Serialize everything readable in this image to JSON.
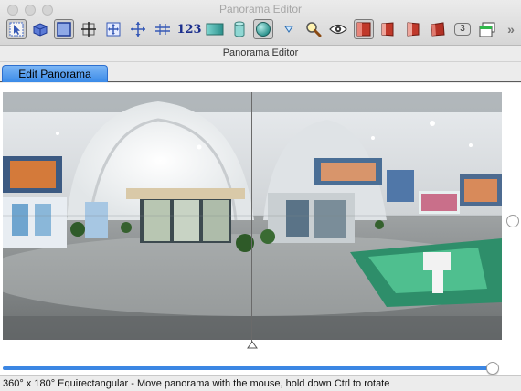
{
  "window": {
    "title": "Panorama Editor"
  },
  "toolbar": {
    "items": [
      {
        "icon": "select-arrow-icon"
      },
      {
        "icon": "cube-view-icon"
      },
      {
        "icon": "crop-frame-icon"
      },
      {
        "icon": "crosshair-center-icon"
      },
      {
        "icon": "fit-arrows-icon"
      },
      {
        "icon": "move-horizontal-vertical-icon"
      },
      {
        "icon": "straighten-icon"
      },
      {
        "icon": "numeric-123-icon",
        "label": "123"
      },
      {
        "icon": "preview-rectangle-icon"
      },
      {
        "icon": "cylinder-icon"
      },
      {
        "icon": "sphere-icon"
      },
      {
        "icon": "dropdown-triangle-icon"
      },
      {
        "icon": "zoom-magnifier-icon"
      },
      {
        "icon": "eye-preview-icon"
      },
      {
        "icon": "cube-face-front-icon"
      },
      {
        "icon": "cube-face-left-icon"
      },
      {
        "icon": "cube-face-right-icon"
      },
      {
        "icon": "cube-face-back-icon"
      },
      {
        "icon": "badge-3-icon",
        "label": "3"
      },
      {
        "icon": "window-green-icon"
      },
      {
        "icon": "overflow-chevrons-icon",
        "label": "»"
      }
    ]
  },
  "editor": {
    "header": "Panorama Editor"
  },
  "tabs": [
    {
      "label": "Edit Panorama"
    }
  ],
  "slider": {
    "value_fraction": 0.99
  },
  "status": {
    "text": "360° x 180° Equirectangular - Move panorama with the mouse, hold down Ctrl to rotate"
  },
  "colors": {
    "accent": "#3b86e3",
    "tab_active": "#5aa2f0"
  }
}
